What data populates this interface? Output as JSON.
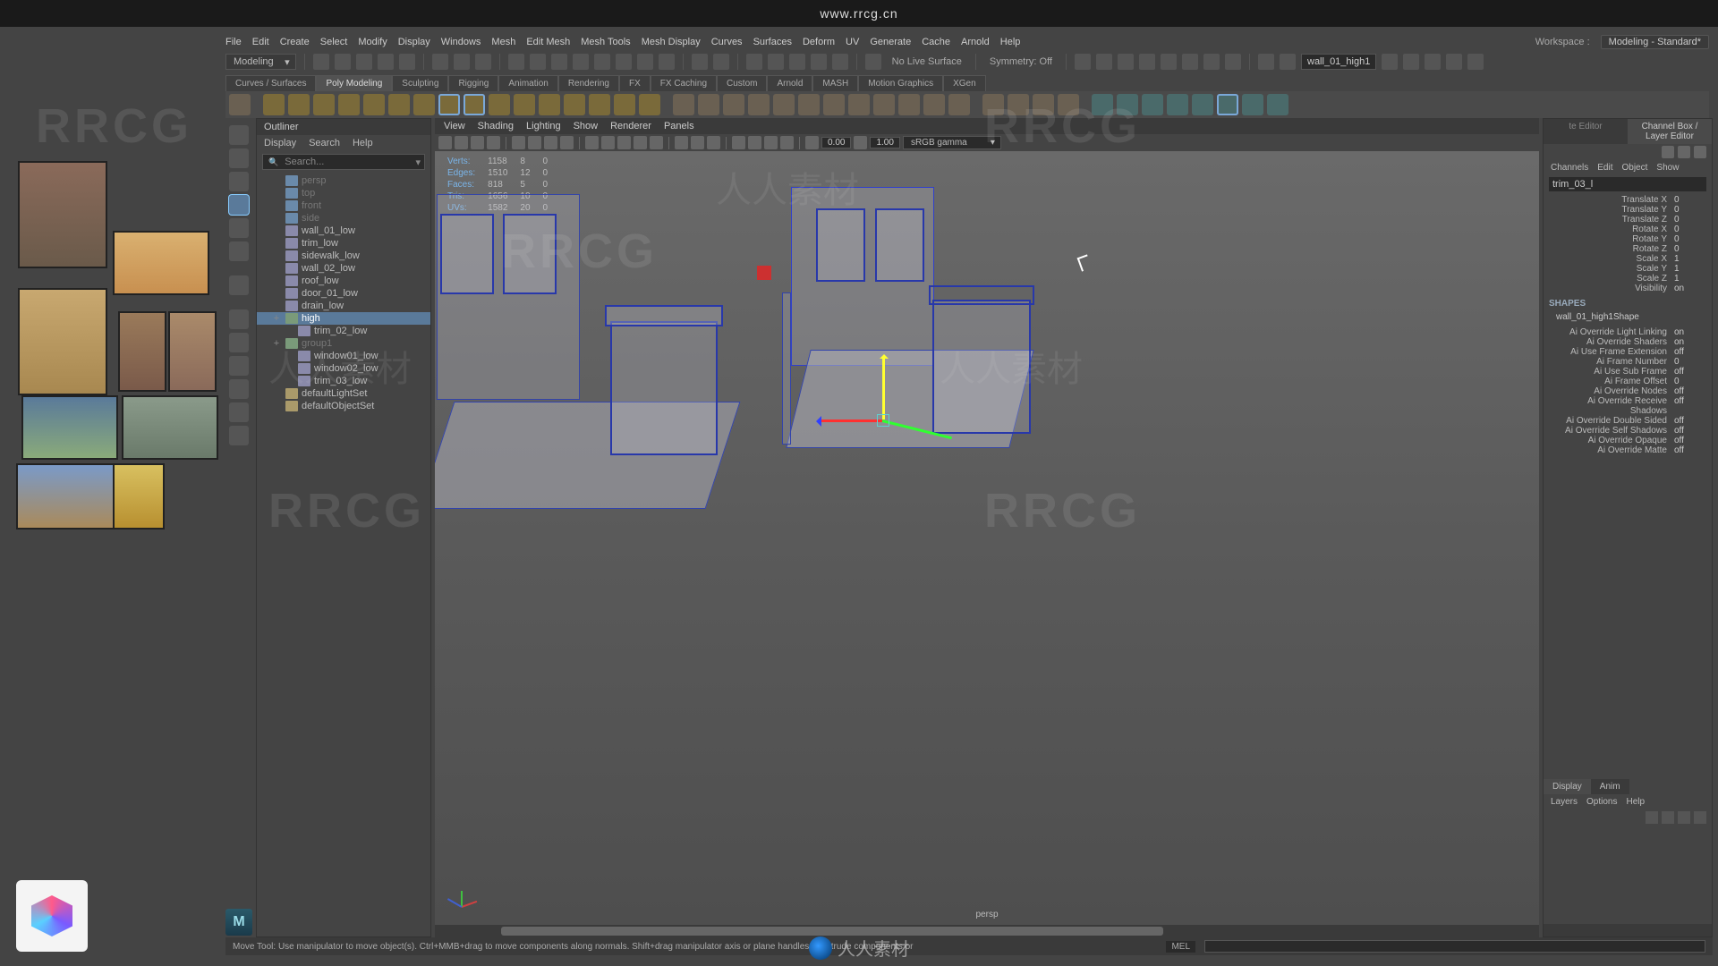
{
  "watermark_url": "www.rrcg.cn",
  "watermark_text": "RRCG",
  "bottom_brand": "人人素材",
  "menus": [
    "File",
    "Edit",
    "Create",
    "Select",
    "Modify",
    "Display",
    "Windows",
    "Mesh",
    "Edit Mesh",
    "Mesh Tools",
    "Mesh Display",
    "Curves",
    "Surfaces",
    "Deform",
    "UV",
    "Generate",
    "Cache",
    "Arnold",
    "Help"
  ],
  "workspace": {
    "label": "Workspace :",
    "value": "Modeling - Standard*"
  },
  "mode_selector": "Modeling",
  "no_live_surface": "No Live Surface",
  "symmetry": "Symmetry: Off",
  "object_field": "wall_01_high1",
  "shelf_tabs": [
    "Curves / Surfaces",
    "Poly Modeling",
    "Sculpting",
    "Rigging",
    "Animation",
    "Rendering",
    "FX",
    "FX Caching",
    "Custom",
    "Arnold",
    "MASH",
    "Motion Graphics",
    "XGen"
  ],
  "shelf_active_index": 1,
  "outliner": {
    "title": "Outliner",
    "menu": [
      "Display",
      "Search",
      "Help"
    ],
    "search_placeholder": "Search...",
    "items": [
      {
        "label": "persp",
        "type": "cam",
        "dim": true,
        "indent": 1
      },
      {
        "label": "top",
        "type": "cam",
        "dim": true,
        "indent": 1
      },
      {
        "label": "front",
        "type": "cam",
        "dim": true,
        "indent": 1
      },
      {
        "label": "side",
        "type": "cam",
        "dim": true,
        "indent": 1
      },
      {
        "label": "wall_01_low",
        "type": "mesh",
        "indent": 1
      },
      {
        "label": "trim_low",
        "type": "mesh",
        "indent": 1
      },
      {
        "label": "sidewalk_low",
        "type": "mesh",
        "indent": 1
      },
      {
        "label": "wall_02_low",
        "type": "mesh",
        "indent": 1
      },
      {
        "label": "roof_low",
        "type": "mesh",
        "indent": 1
      },
      {
        "label": "door_01_low",
        "type": "mesh",
        "indent": 1
      },
      {
        "label": "drain_low",
        "type": "mesh",
        "indent": 1
      },
      {
        "label": "high",
        "type": "grp",
        "indent": 1,
        "exp": "+",
        "sel": true
      },
      {
        "label": "trim_02_low",
        "type": "mesh",
        "indent": 2
      },
      {
        "label": "group1",
        "type": "grp",
        "indent": 1,
        "exp": "+",
        "dim": true
      },
      {
        "label": "window01_low",
        "type": "mesh",
        "indent": 2
      },
      {
        "label": "window02_low",
        "type": "mesh",
        "indent": 2
      },
      {
        "label": "trim_03_low",
        "type": "mesh",
        "indent": 2
      },
      {
        "label": "defaultLightSet",
        "type": "light",
        "indent": 1
      },
      {
        "label": "defaultObjectSet",
        "type": "light",
        "indent": 1
      }
    ]
  },
  "viewport": {
    "menu": [
      "View",
      "Shading",
      "Lighting",
      "Show",
      "Renderer",
      "Panels"
    ],
    "exposure": "0.00",
    "gamma": "1.00",
    "colorspace": "sRGB gamma",
    "hud": {
      "rows": [
        {
          "label": "Verts:",
          "a": "1158",
          "b": "8",
          "c": "0"
        },
        {
          "label": "Edges:",
          "a": "1510",
          "b": "12",
          "c": "0"
        },
        {
          "label": "Faces:",
          "a": "818",
          "b": "5",
          "c": "0"
        },
        {
          "label": "Tris:",
          "a": "1656",
          "b": "10",
          "c": "0"
        },
        {
          "label": "UVs:",
          "a": "1582",
          "b": "20",
          "c": "0"
        }
      ]
    },
    "camera_label": "persp"
  },
  "channel_box": {
    "header_tabs": [
      "te Editor",
      "Channel Box / Layer Editor"
    ],
    "menu": [
      "Channels",
      "Edit",
      "Object",
      "Show"
    ],
    "node_name": "trim_03_l",
    "attrs": [
      {
        "l": "Translate X",
        "v": "0"
      },
      {
        "l": "Translate Y",
        "v": "0"
      },
      {
        "l": "Translate Z",
        "v": "0"
      },
      {
        "l": "Rotate X",
        "v": "0"
      },
      {
        "l": "Rotate Y",
        "v": "0"
      },
      {
        "l": "Rotate Z",
        "v": "0"
      },
      {
        "l": "Scale X",
        "v": "1"
      },
      {
        "l": "Scale Y",
        "v": "1"
      },
      {
        "l": "Scale Z",
        "v": "1"
      },
      {
        "l": "Visibility",
        "v": "on"
      }
    ],
    "shapes_header": "SHAPES",
    "shape_name": "wall_01_high1Shape",
    "shape_attrs": [
      {
        "l": "Ai Override Light Linking",
        "v": "on"
      },
      {
        "l": "Ai Override Shaders",
        "v": "on"
      },
      {
        "l": "Ai Use Frame Extension",
        "v": "off"
      },
      {
        "l": "Ai Frame Number",
        "v": "0"
      },
      {
        "l": "Ai Use Sub Frame",
        "v": "off"
      },
      {
        "l": "Ai Frame Offset",
        "v": "0"
      },
      {
        "l": "Ai Override Nodes",
        "v": "off"
      },
      {
        "l": "Ai Override Receive Shadows",
        "v": "off"
      },
      {
        "l": "Ai Override Double Sided",
        "v": "off"
      },
      {
        "l": "Ai Override Self Shadows",
        "v": "off"
      },
      {
        "l": "Ai Override Opaque",
        "v": "off"
      },
      {
        "l": "Ai Override Matte",
        "v": "off"
      }
    ],
    "display_tabs": [
      "Display",
      "Anim"
    ],
    "display_menu": [
      "Layers",
      "Options",
      "Help"
    ]
  },
  "status": {
    "help": "Move Tool: Use manipulator to move object(s). Ctrl+MMB+drag to move components along normals. Shift+drag manipulator axis or plane handles to extrude components or",
    "mel": "MEL"
  }
}
